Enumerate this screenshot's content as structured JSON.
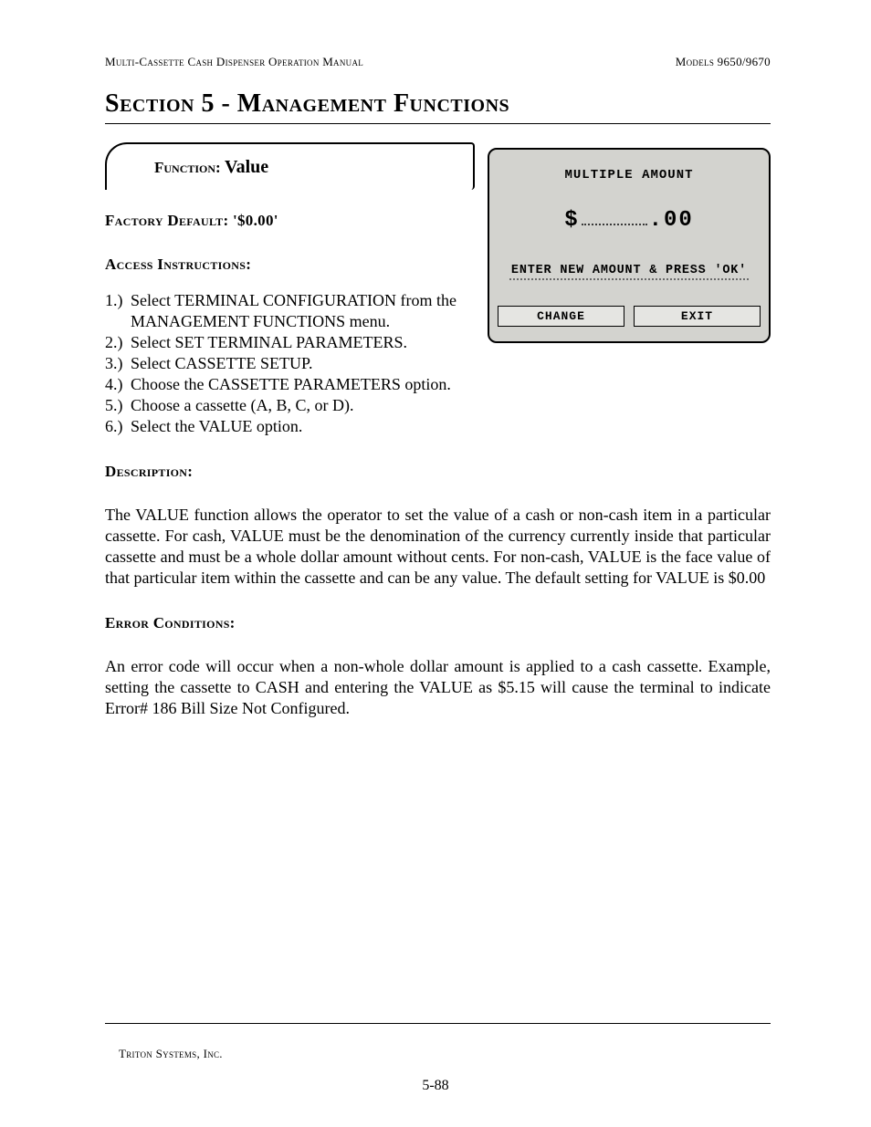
{
  "header": {
    "left": "Multi-Cassette Cash Dispenser Operation Manual",
    "right": "Models 9650/9670"
  },
  "section_title": "Section 5 - Management Functions",
  "function_box": {
    "label": "Function:",
    "value": "Value"
  },
  "screen": {
    "title": "MULTIPLE AMOUNT",
    "currency": "$",
    "fraction": ".00",
    "instruction": "ENTER NEW AMOUNT & PRESS 'OK'",
    "buttons": {
      "change": "CHANGE",
      "exit": "EXIT"
    }
  },
  "factory_default": {
    "label": "Factory Default:",
    "value": "'$0.00'"
  },
  "access": {
    "heading": "Access Instructions:",
    "items": [
      "Select TERMINAL CONFIGURATION from the MANAGEMENT FUNCTIONS menu.",
      "Select SET TERMINAL PARAMETERS.",
      "Select CASSETTE SETUP.",
      "Choose the CASSETTE PARAMETERS option.",
      "Choose a cassette (A, B, C, or D).",
      "Select the VALUE option."
    ]
  },
  "description": {
    "heading": "Description:",
    "text": "The VALUE function allows the operator to set the value of a cash or non-cash item in a particular cassette.  For cash, VALUE must be the denomination of the currency currently inside that particular cassette and must be a whole dollar amount without cents.  For non-cash, VALUE is the face value of that particular item within the cassette and can be any value.  The default setting for VALUE is $0.00"
  },
  "error": {
    "heading": "Error Conditions:",
    "text": "An error code will occur when a non-whole dollar amount is applied to a cash cassette.  Example, setting the cassette to CASH and entering the VALUE as $5.15 will cause the terminal to indicate Error# 186 Bill Size Not Configured."
  },
  "footer": {
    "company": "Triton Systems, Inc.",
    "page": "5-88"
  }
}
